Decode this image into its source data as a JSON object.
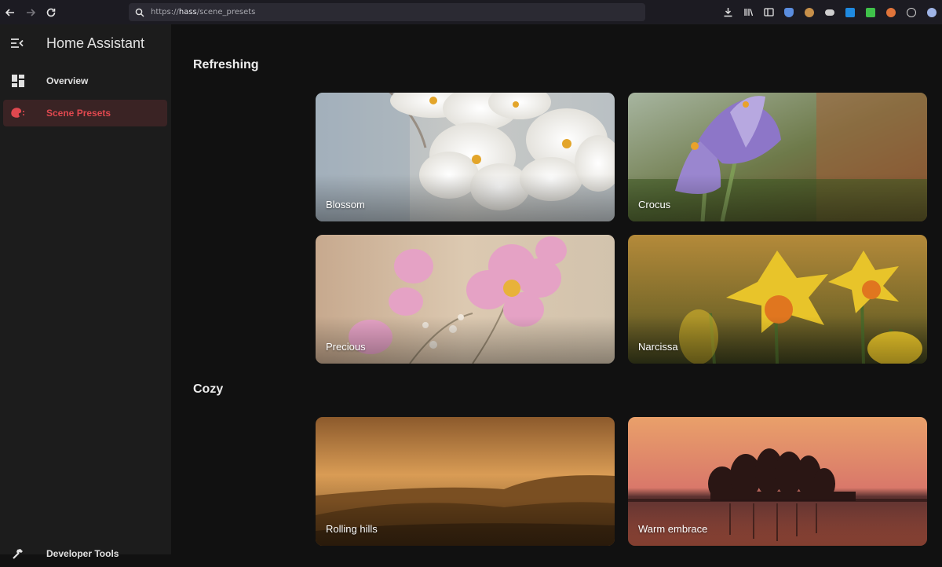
{
  "browser": {
    "url_prefix": "https://",
    "url_host": "hass",
    "url_path": "/scene_presets",
    "extension_colors": [
      "#5a8dde",
      "#c7904a",
      "#cfcfcf",
      "#1f8ae0",
      "#3fc24a",
      "#e0743a",
      "#cfcfcf",
      "#9fb4e6"
    ]
  },
  "sidebar": {
    "title": "Home Assistant",
    "items": [
      {
        "label": "Overview",
        "icon": "view-dashboard-icon"
      },
      {
        "label": "Scene Presets",
        "icon": "palette-icon"
      },
      {
        "label": "Developer Tools",
        "icon": "hammer-icon"
      }
    ],
    "accent": "#e0484f"
  },
  "sections": [
    {
      "title": "Refreshing",
      "cards": [
        {
          "name": "Blossom"
        },
        {
          "name": "Crocus"
        },
        {
          "name": "Precious"
        },
        {
          "name": "Narcissa"
        }
      ]
    },
    {
      "title": "Cozy",
      "cards": [
        {
          "name": "Rolling hills"
        },
        {
          "name": "Warm embrace"
        }
      ]
    }
  ]
}
